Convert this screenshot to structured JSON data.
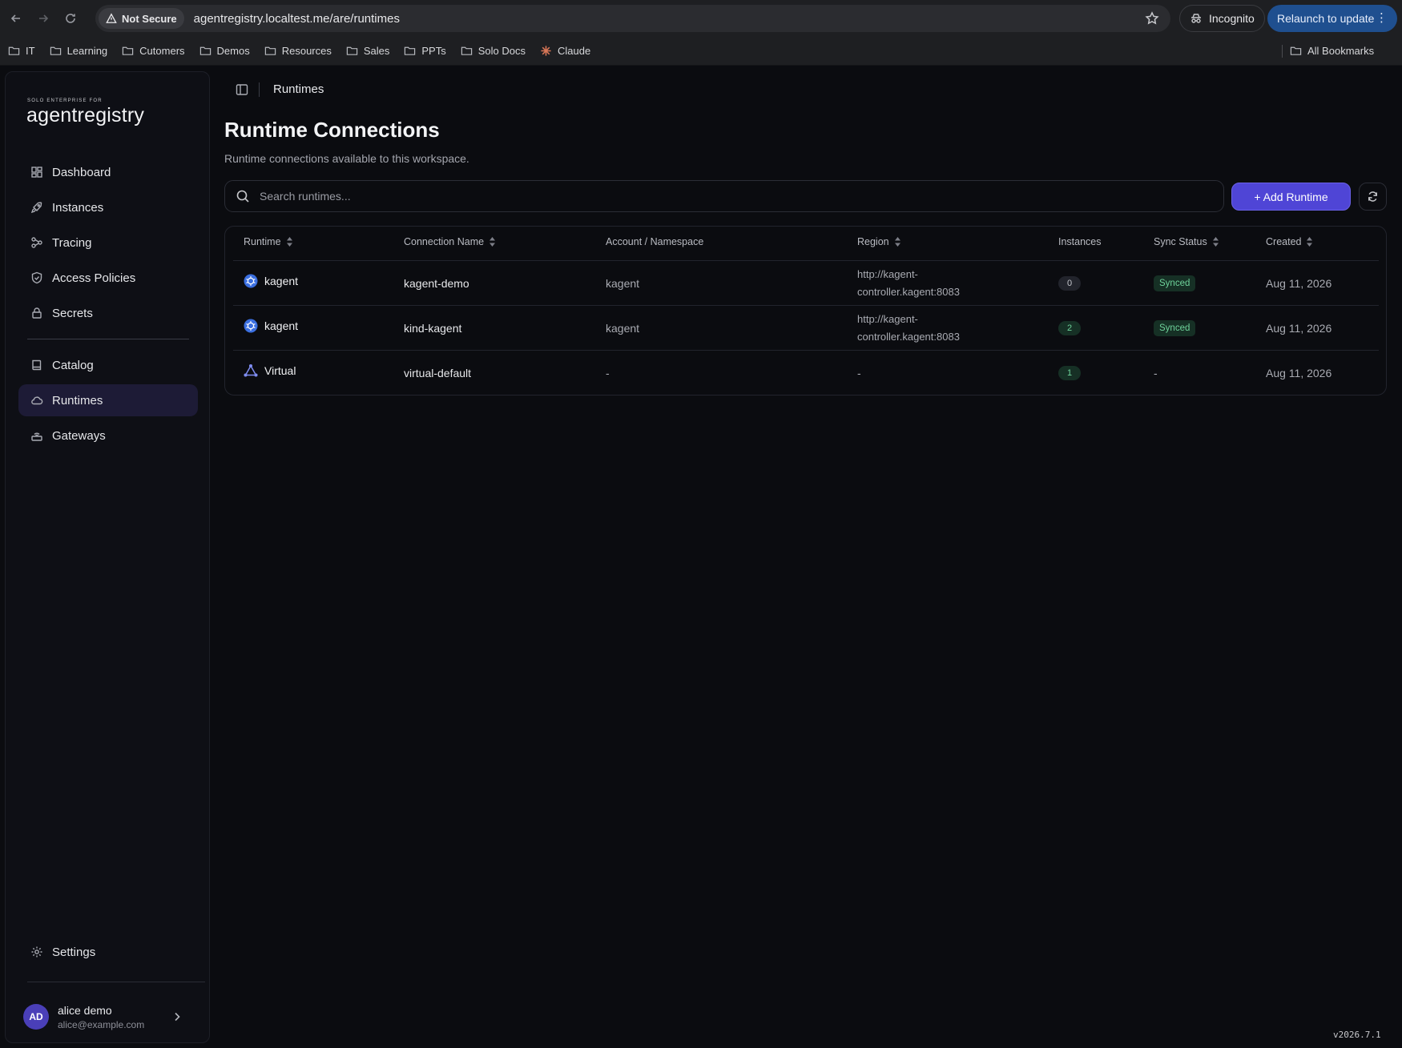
{
  "browser": {
    "security_label": "Not Secure",
    "url": "agentregistry.localtest.me/are/runtimes",
    "incognito_label": "Incognito",
    "relaunch_label": "Relaunch to update",
    "bookmarks": [
      "IT",
      "Learning",
      "Cutomers",
      "Demos",
      "Resources",
      "Sales",
      "PPTs",
      "Solo Docs",
      "Claude"
    ],
    "all_bookmarks_label": "All Bookmarks"
  },
  "sidebar": {
    "brand_small": "SOLO ENTERPRISE FOR",
    "brand": "agentregistry",
    "items": [
      {
        "label": "Dashboard",
        "icon": "dashboard-icon"
      },
      {
        "label": "Instances",
        "icon": "rocket-icon"
      },
      {
        "label": "Tracing",
        "icon": "tracing-icon"
      },
      {
        "label": "Access Policies",
        "icon": "shield-icon"
      },
      {
        "label": "Secrets",
        "icon": "lock-icon"
      },
      {
        "label": "Catalog",
        "icon": "book-icon"
      },
      {
        "label": "Runtimes",
        "icon": "cloud-icon"
      },
      {
        "label": "Gateways",
        "icon": "router-icon"
      }
    ],
    "active_item": "Runtimes",
    "settings_label": "Settings",
    "user": {
      "initials": "AD",
      "name": "alice demo",
      "email": "alice@example.com"
    }
  },
  "main": {
    "breadcrumb": "Runtimes",
    "title": "Runtime Connections",
    "subtitle": "Runtime connections available to this workspace.",
    "search_placeholder": "Search runtimes...",
    "add_button_label": "+ Add Runtime",
    "columns": [
      "Runtime",
      "Connection Name",
      "Account / Namespace",
      "Region",
      "Instances",
      "Sync Status",
      "Created"
    ],
    "rows": [
      {
        "runtime": "kagent",
        "runtime_icon": "kubernetes-icon",
        "connection": "kagent-demo",
        "namespace": "kagent",
        "region_line1": "http://kagent-",
        "region_line2": "controller.kagent:8083",
        "instances": "0",
        "sync": "Synced",
        "created": "Aug 11, 2026"
      },
      {
        "runtime": "kagent",
        "runtime_icon": "kubernetes-icon",
        "connection": "kind-kagent",
        "namespace": "kagent",
        "region_line1": "http://kagent-",
        "region_line2": "controller.kagent:8083",
        "instances": "2",
        "sync": "Synced",
        "created": "Aug 11, 2026"
      },
      {
        "runtime": "Virtual",
        "runtime_icon": "triangle-icon",
        "connection": "virtual-default",
        "namespace": "-",
        "region_line1": "-",
        "region_line2": "",
        "instances": "1",
        "sync": "-",
        "created": "Aug 11, 2026"
      }
    ]
  },
  "version": "v2026.7.1"
}
